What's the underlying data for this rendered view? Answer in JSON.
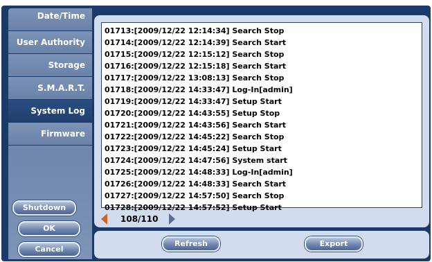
{
  "sidebar": {
    "items": [
      {
        "label": "Date/Time"
      },
      {
        "label": "User Authority"
      },
      {
        "label": "Storage"
      },
      {
        "label": "S.M.A.R.T."
      },
      {
        "label": "System Log"
      },
      {
        "label": "Firmware"
      }
    ],
    "active_index": 4
  },
  "buttons": {
    "shutdown": "Shutdown",
    "ok": "OK",
    "cancel": "Cancel",
    "refresh": "Refresh",
    "export": "Export"
  },
  "log": {
    "lines": [
      "01713:[2009/12/22 12:14:34] Search Stop",
      "01714:[2009/12/22 12:14:39] Search Start",
      "01715:[2009/12/22 12:15:12] Search Stop",
      "01716:[2009/12/22 12:15:18] Search Start",
      "01717:[2009/12/22 13:08:13] Search Stop",
      "01718:[2009/12/22 14:33:47] Log-In[admin]",
      "01719:[2009/12/22 14:33:47] Setup Start",
      "01720:[2009/12/22 14:43:55] Setup Stop",
      "01721:[2009/12/22 14:43:56] Search Start",
      "01722:[2009/12/22 14:45:22] Search Stop",
      "01723:[2009/12/22 14:45:24] Setup Start",
      "01724:[2009/12/22 14:47:56] System start",
      "01725:[2009/12/22 14:48:33] Log-In[admin]",
      "01726:[2009/12/22 14:48:33] Search Start",
      "01727:[2009/12/22 14:57:50] Search Stop",
      "01728:[2009/12/22 14:57:52] Setup Start"
    ]
  },
  "pager": {
    "text": "108/110"
  },
  "colors": {
    "frame": "#1a3a6a",
    "sidebar_item": "#7c93b7",
    "sidebar_active": "#2a4d82",
    "panel": "#d1ddef",
    "prev_arrow": "#d06428",
    "next_arrow": "#5e6f87"
  },
  "icons": {
    "prev": "triangle-left-icon",
    "next": "triangle-right-icon"
  }
}
